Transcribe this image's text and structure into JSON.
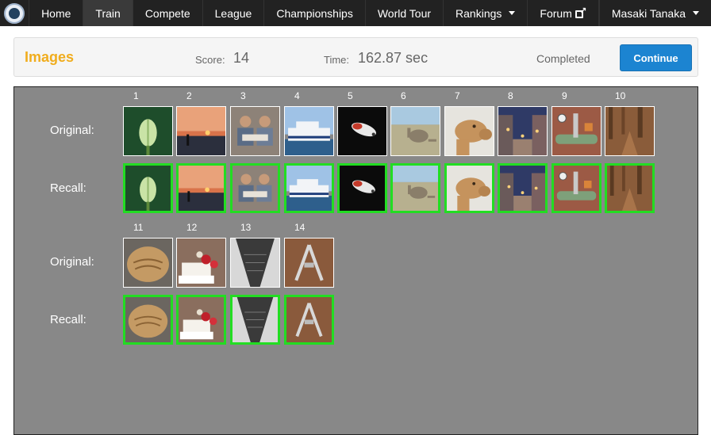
{
  "nav": {
    "items": [
      {
        "label": "Home",
        "active": false
      },
      {
        "label": "Train",
        "active": true
      },
      {
        "label": "Compete",
        "active": false
      },
      {
        "label": "League",
        "active": false
      },
      {
        "label": "Championships",
        "active": false
      },
      {
        "label": "World Tour",
        "active": false
      },
      {
        "label": "Rankings",
        "active": false
      },
      {
        "label": "Forum",
        "active": false
      }
    ],
    "user": "Masaki Tanaka"
  },
  "header": {
    "title": "Images",
    "score_label": "Score:",
    "score_value": "14",
    "time_label": "Time:",
    "time_value": "162.87 sec",
    "status": "Completed",
    "continue_label": "Continue"
  },
  "labels": {
    "original": "Original:",
    "recall": "Recall:"
  },
  "images": [
    {
      "number": "1",
      "subject": "flower-bud"
    },
    {
      "number": "2",
      "subject": "sunset-fisherman"
    },
    {
      "number": "3",
      "subject": "children-reading"
    },
    {
      "number": "4",
      "subject": "ferry-ship"
    },
    {
      "number": "5",
      "subject": "fish-on-black"
    },
    {
      "number": "6",
      "subject": "kangaroo"
    },
    {
      "number": "7",
      "subject": "camel"
    },
    {
      "number": "8",
      "subject": "evening-street"
    },
    {
      "number": "9",
      "subject": "pipes-gauges"
    },
    {
      "number": "10",
      "subject": "forest-path"
    },
    {
      "number": "11",
      "subject": "bread-loaf"
    },
    {
      "number": "12",
      "subject": "wedding-cake"
    },
    {
      "number": "13",
      "subject": "escalator"
    },
    {
      "number": "14",
      "subject": "multi-tool"
    }
  ],
  "colors": {
    "accent": "#f0ad1e",
    "button": "#1c84d1",
    "recall_border": "#22dd22",
    "stage": "#888888"
  }
}
